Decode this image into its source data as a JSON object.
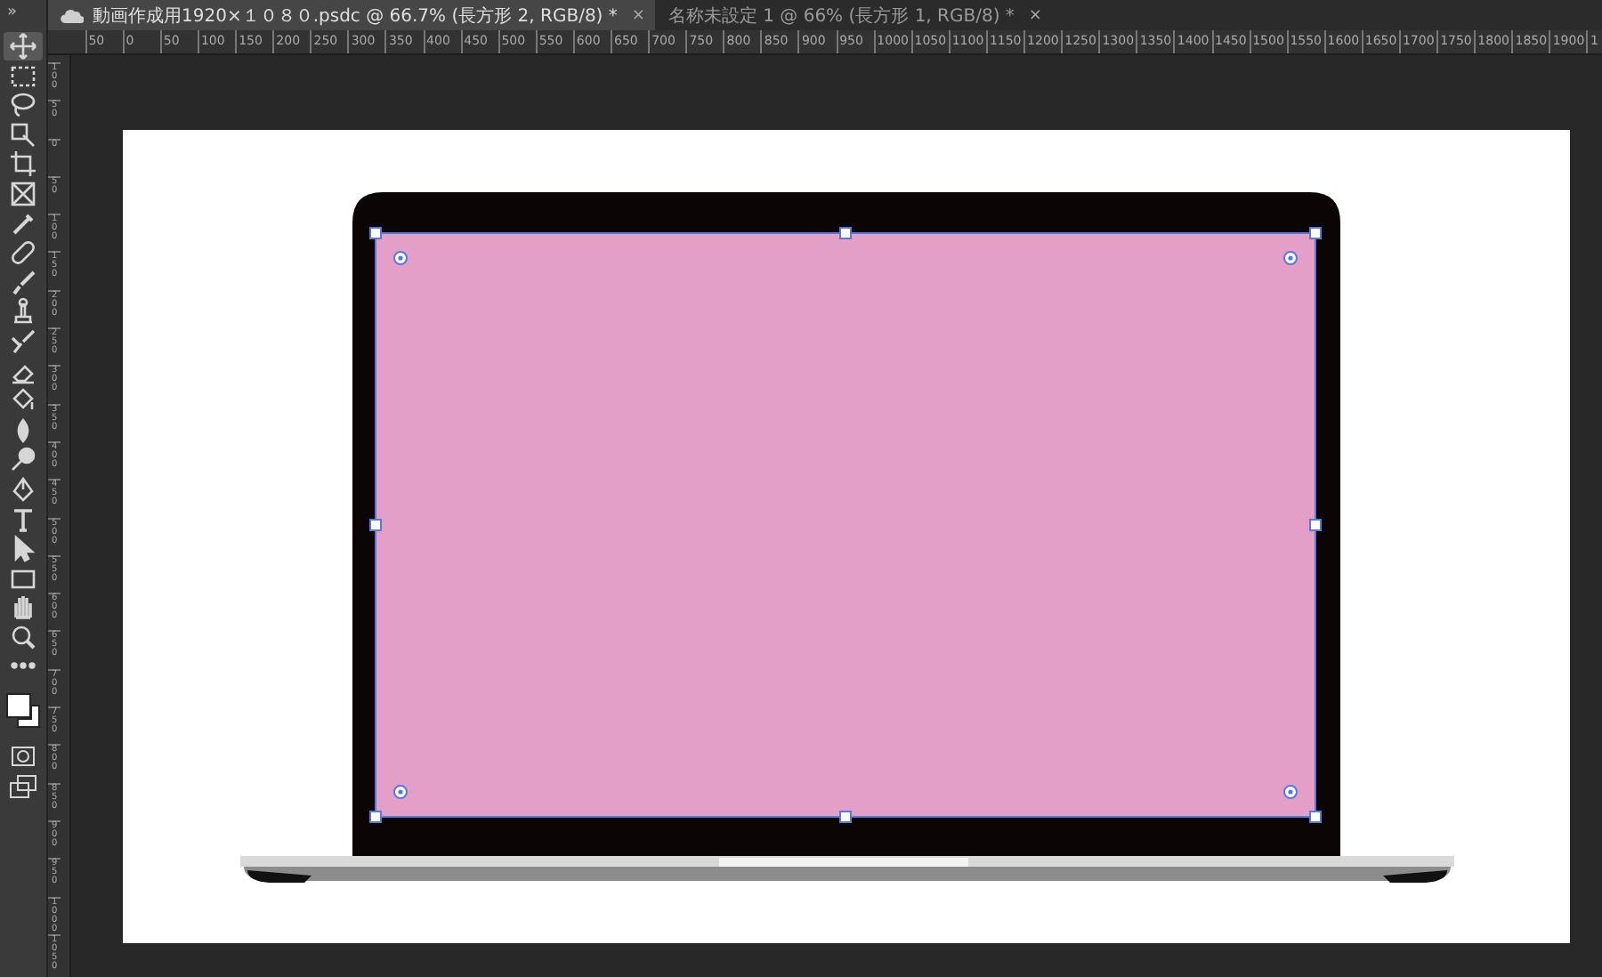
{
  "toolbar": {
    "collapse": "»",
    "tools": [
      {
        "kind": "move",
        "selected": true
      },
      {
        "kind": "marquee",
        "selected": false
      },
      {
        "kind": "lasso",
        "selected": false
      },
      {
        "kind": "select",
        "selected": false
      },
      {
        "kind": "crop",
        "selected": false
      },
      {
        "kind": "frame",
        "selected": false
      },
      {
        "kind": "eyedropper",
        "selected": false
      },
      {
        "kind": "healing",
        "selected": false
      },
      {
        "kind": "brush",
        "selected": false
      },
      {
        "kind": "stamp",
        "selected": false
      },
      {
        "kind": "history",
        "selected": false
      },
      {
        "kind": "eraser",
        "selected": false
      },
      {
        "kind": "bucket",
        "selected": false
      },
      {
        "kind": "blur",
        "selected": false
      },
      {
        "kind": "dodge",
        "selected": false
      },
      {
        "kind": "pen",
        "selected": false
      },
      {
        "kind": "type",
        "selected": false
      },
      {
        "kind": "path",
        "selected": false
      },
      {
        "kind": "rect",
        "selected": false
      },
      {
        "kind": "hand",
        "selected": false
      },
      {
        "kind": "zoom",
        "selected": false
      },
      {
        "kind": "more",
        "selected": false
      }
    ]
  },
  "tabs": [
    {
      "label": "動画作成用1920×１０８０.psdc @ 66.7% (長方形 2, RGB/8) *",
      "cloud": true,
      "close": "×",
      "selected": true
    },
    {
      "label": "名称未設定 1 @ 66% (長方形 1, RGB/8) *",
      "cloud": false,
      "close": "×",
      "selected": false
    }
  ],
  "ruler_h": [
    "50",
    "0",
    "50",
    "100",
    "150",
    "200",
    "250",
    "300",
    "350",
    "400",
    "450",
    "500",
    "550",
    "600",
    "650",
    "700",
    "750",
    "800",
    "850",
    "900",
    "950",
    "1000",
    "1050",
    "1100",
    "1150",
    "1200",
    "1250",
    "1300",
    "1350",
    "1400",
    "1450",
    "1500",
    "1550",
    "1600",
    "1650",
    "1700",
    "1750",
    "1800",
    "1850",
    "1900",
    "1"
  ],
  "ruler_v": [
    "100",
    "50",
    "0",
    "50",
    "100",
    "150",
    "200",
    "250",
    "300",
    "350",
    "400",
    "450",
    "500",
    "550",
    "600",
    "650",
    "700",
    "750",
    "800",
    "850",
    "900",
    "950",
    "1000",
    "1050"
  ]
}
